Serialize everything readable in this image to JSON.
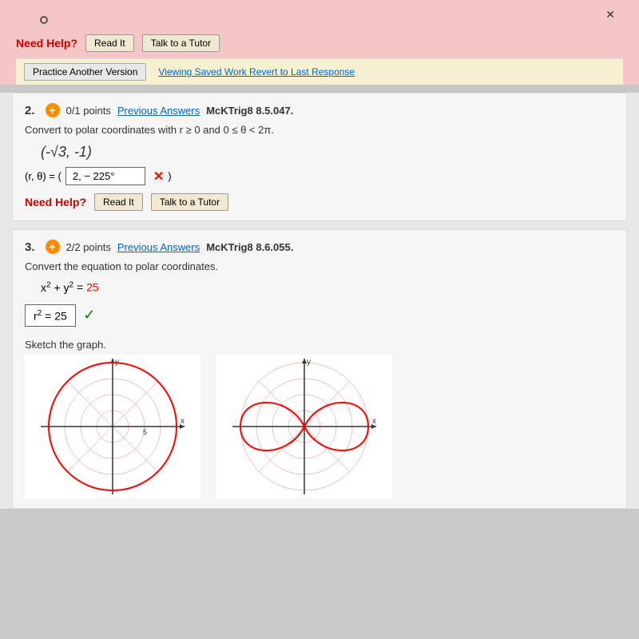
{
  "top": {
    "need_help_label": "Need Help?",
    "read_it_btn": "Read It",
    "talk_tutor_btn": "Talk to a Tutor",
    "practice_btn": "Practice Another Version",
    "viewing_text": "Viewing Saved Work Revert to Last Response"
  },
  "question2": {
    "number": "2.",
    "points": "0/1 points",
    "prev_answers": "Previous Answers",
    "code": "McKTrig8 8.5.047.",
    "instruction": "Convert to polar coordinates with r ≥ 0 and 0 ≤ θ < 2π.",
    "expression": "(-√3, -1)",
    "answer_prefix": "(r, θ) = (",
    "answer_value": "2, − 225°",
    "answer_suffix": ")",
    "need_help_label": "Need Help?",
    "read_it_btn": "Read It",
    "talk_tutor_btn": "Talk to a Tutor"
  },
  "question3": {
    "number": "3.",
    "points": "2/2 points",
    "prev_answers": "Previous Answers",
    "code": "McKTrig8 8.6.055.",
    "instruction": "Convert the equation to polar coordinates.",
    "equation_left": "x² + y²",
    "equation_equals": " = ",
    "equation_right": "25",
    "answer_value": "r² = 25",
    "sketch_label": "Sketch the graph."
  }
}
